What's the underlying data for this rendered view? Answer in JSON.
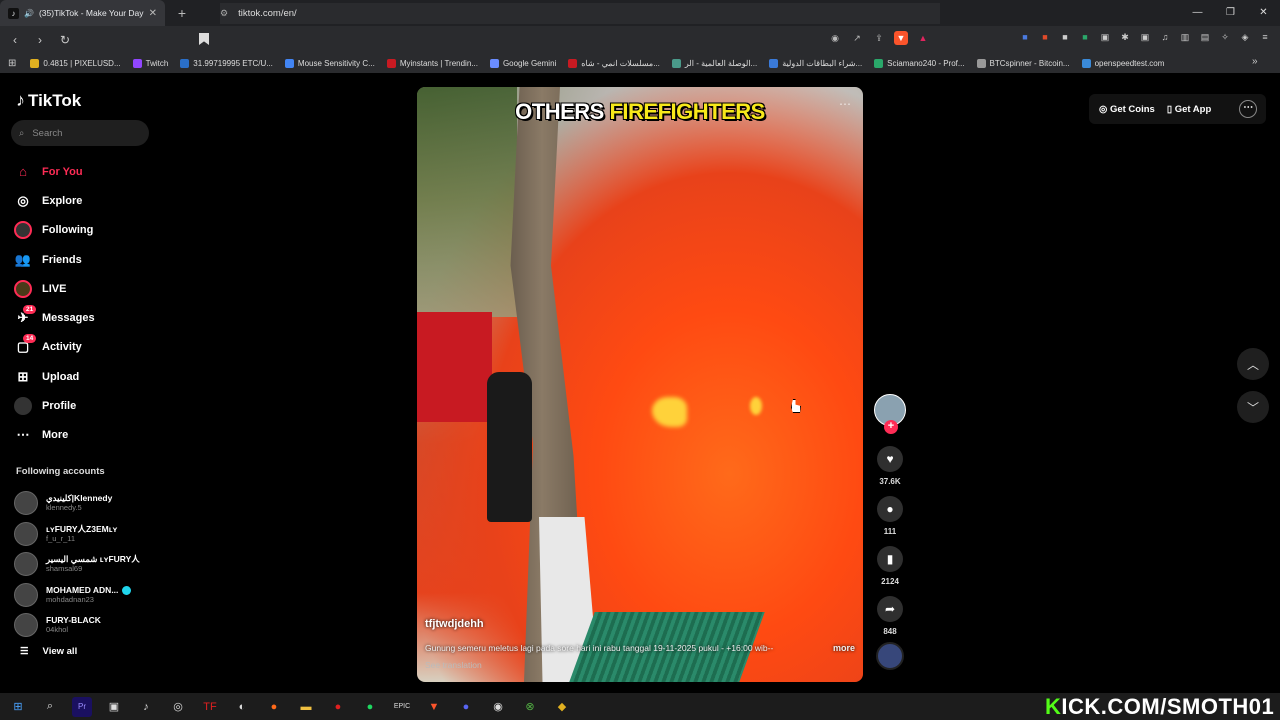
{
  "browser": {
    "tab_title": "(35)TikTok - Make Your Day",
    "url": "tiktok.com/en/",
    "new_tab": "+",
    "window_controls": [
      "—",
      "❐",
      "✕"
    ],
    "bookmarks": [
      {
        "label": "0.4815 | PIXELUSD...",
        "color": "#e0b020"
      },
      {
        "label": "Twitch",
        "color": "#9146ff"
      },
      {
        "label": "31.99719995 ETC/U...",
        "color": "#2a6fc9"
      },
      {
        "label": "Mouse Sensitivity C...",
        "color": "#4285f4"
      },
      {
        "label": "Myinstants | Trendin...",
        "color": "#c81a22"
      },
      {
        "label": "Google Gemini",
        "color": "#6a8cff"
      },
      {
        "label": "مسلسلات انمي - شاه...",
        "color": "#c81a22"
      },
      {
        "label": "الوصلة العالمية - الر...",
        "color": "#4a9a8a"
      },
      {
        "label": "شراء البطاقات الدولية...",
        "color": "#3a7ad9"
      },
      {
        "label": "Sciamano240 - Prof...",
        "color": "#2aa86a"
      },
      {
        "label": "BTCspinner - Bitcoin...",
        "color": "#999999"
      },
      {
        "label": "openspeedtest.com",
        "color": "#3a8ad9"
      }
    ]
  },
  "sidebar": {
    "logo": "TikTok",
    "search_placeholder": "Search",
    "nav": [
      {
        "label": "For You",
        "icon": "home-icon",
        "active": true
      },
      {
        "label": "Explore",
        "icon": "compass-icon"
      },
      {
        "label": "Following",
        "icon": "following-avatar-icon"
      },
      {
        "label": "Friends",
        "icon": "friends-icon"
      },
      {
        "label": "LIVE",
        "icon": "live-icon"
      },
      {
        "label": "Messages",
        "icon": "messages-icon",
        "badge": "21"
      },
      {
        "label": "Activity",
        "icon": "activity-icon",
        "badge": "14"
      },
      {
        "label": "Upload",
        "icon": "upload-icon"
      },
      {
        "label": "Profile",
        "icon": "profile-avatar-icon"
      },
      {
        "label": "More",
        "icon": "more-icon"
      }
    ],
    "following_title": "Following accounts",
    "accounts": [
      {
        "display": "كلينيدي|Klennedy",
        "user": "klennedy.5"
      },
      {
        "display": "ʟʏFURY人Z3EMʟʏ",
        "user": "f_u_r_11"
      },
      {
        "display": "شمسي اليسير ʟʏFURY人",
        "user": "shamsal69"
      },
      {
        "display": "MOHAMED ADN...",
        "user": "mohdadnan23",
        "verified": true
      },
      {
        "display": "FURY-BLACK",
        "user": "04khol"
      }
    ],
    "view_all": "View all"
  },
  "video": {
    "overlay_word1": "OTHERS",
    "overlay_word2": "FIREFIGHTERS",
    "author": "tfjtwdjdehh",
    "description": "Gunung semeru meletus lagi pada sore hari ini rabu tanggal 19-11-2025 pukul - +16:00 wib--",
    "more": "more",
    "see_translation": "See translation"
  },
  "actions": {
    "likes": "37.6K",
    "comments": "111",
    "saves": "2124",
    "shares": "848"
  },
  "topbar": {
    "get_coins": "Get Coins",
    "get_app": "Get App"
  },
  "overlay": {
    "kick_k": "K",
    "kick_rest": "ICK.COM/SMOTH01"
  },
  "colors": {
    "accent": "#fe2c55",
    "caption_yellow": "#f7e81a",
    "kick_green": "#53fc18"
  }
}
